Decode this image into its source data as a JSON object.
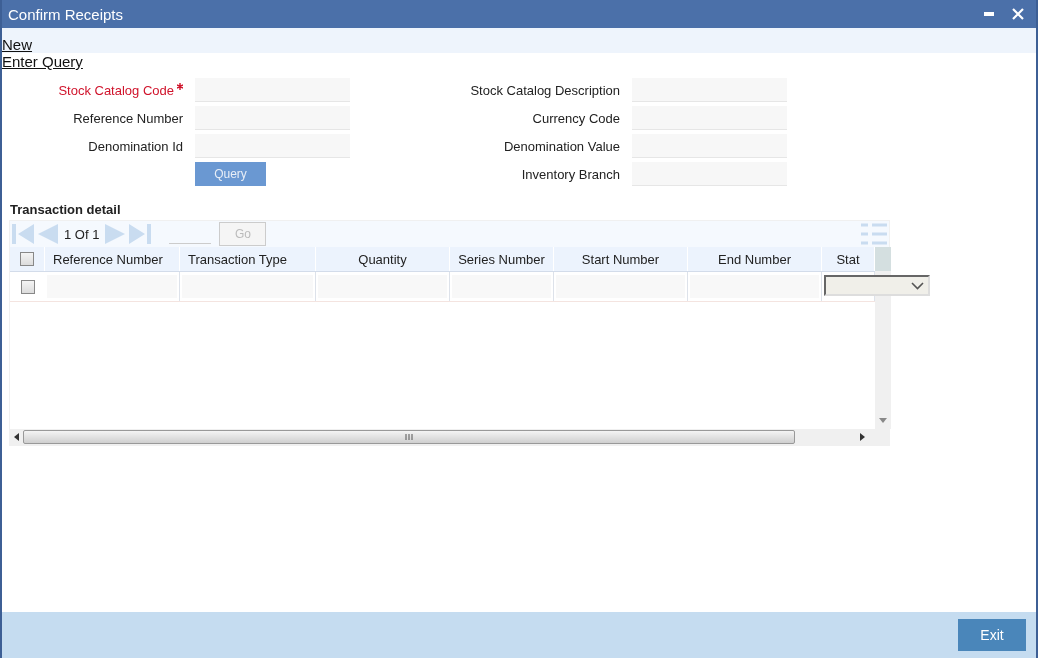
{
  "window": {
    "title": "Confirm Receipts"
  },
  "actions": [
    "New",
    "Enter Query"
  ],
  "form": {
    "left": [
      {
        "label": "Stock Catalog Code",
        "required": true
      },
      {
        "label": "Reference Number",
        "required": false
      },
      {
        "label": "Denomination Id",
        "required": false
      }
    ],
    "query_button": "Query",
    "right": [
      {
        "label": "Stock Catalog Description",
        "required": false
      },
      {
        "label": "Currency Code",
        "required": false
      },
      {
        "label": "Denomination Value",
        "required": false
      },
      {
        "label": "Inventory Branch",
        "required": false
      }
    ]
  },
  "transaction_detail": {
    "title": "Transaction detail",
    "pagination": "1 Of 1",
    "go_button": "Go",
    "select_all_checked": false,
    "columns": [
      "Reference Number",
      "Transaction Type",
      "Quantity",
      "Series Number",
      "Start Number",
      "End Number",
      "Stat"
    ],
    "rows": [
      {
        "checked": false
      }
    ]
  },
  "footer": {
    "buttons": [
      "Exit"
    ]
  }
}
